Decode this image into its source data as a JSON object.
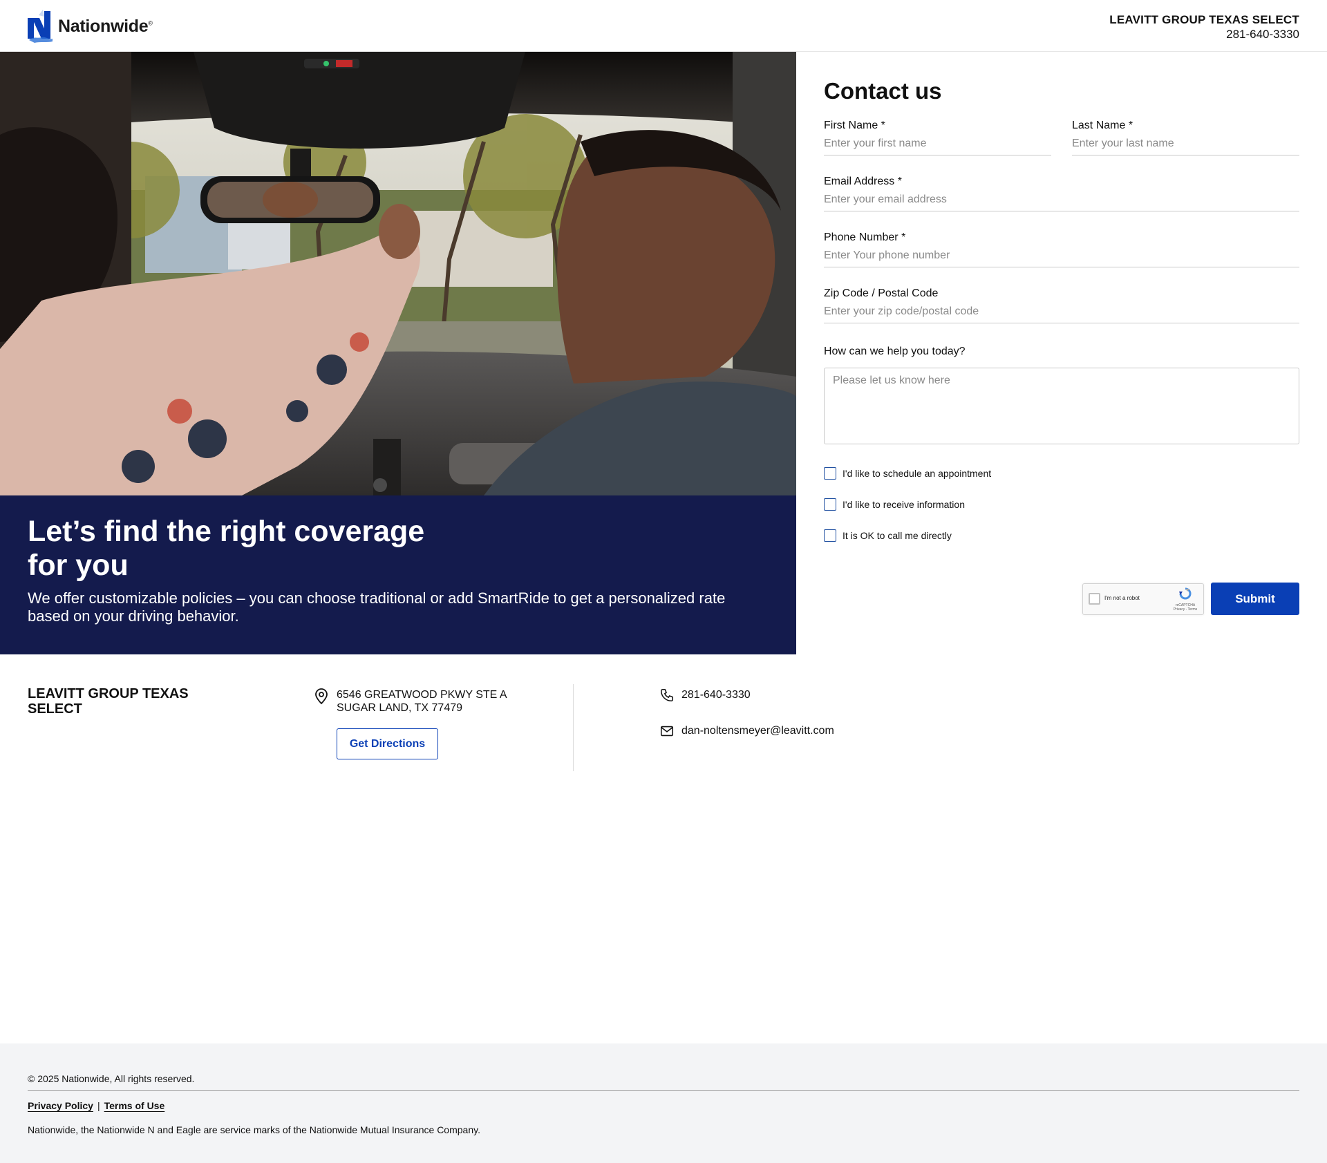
{
  "header": {
    "logo_text": "Nationwide",
    "logo_reg": "®",
    "agency_name": "LEAVITT GROUP TEXAS SELECT",
    "phone": "281-640-3330"
  },
  "hero": {
    "title": "Let’s find the right coverage for you",
    "subtitle": "We offer customizable policies – you can choose traditional or add SmartRide to get a personalized rate based on your driving behavior."
  },
  "form": {
    "title": "Contact us",
    "first_name": {
      "label": "First Name *",
      "placeholder": "Enter your first name",
      "value": ""
    },
    "last_name": {
      "label": "Last Name *",
      "placeholder": "Enter your last name",
      "value": ""
    },
    "email": {
      "label": "Email Address *",
      "placeholder": "Enter your email address",
      "value": ""
    },
    "phone": {
      "label": "Phone Number *",
      "placeholder": "Enter Your phone number",
      "value": ""
    },
    "zip": {
      "label": "Zip Code / Postal Code",
      "placeholder": "Enter your zip code/postal code",
      "value": ""
    },
    "help": {
      "label": "How can we help you today?",
      "placeholder": "Please let us know here"
    },
    "checkboxes": [
      {
        "label": "I'd like to schedule an appointment",
        "checked": false
      },
      {
        "label": "I'd like to receive information",
        "checked": false
      },
      {
        "label": "It is OK to call me directly",
        "checked": false
      }
    ],
    "recaptcha": {
      "label": "I'm not a robot",
      "brand": "reCAPTCHA",
      "links": "Privacy - Terms"
    },
    "submit_label": "Submit"
  },
  "agency": {
    "name": "LEAVITT GROUP TEXAS SELECT",
    "address_line1": "6546 GREATWOOD PKWY STE A",
    "address_line2": "SUGAR LAND, TX 77479",
    "directions_label": "Get Directions",
    "phone": "281-640-3330",
    "email": "dan-noltensmeyer@leavitt.com"
  },
  "footer": {
    "copyright": "© 2025 Nationwide, All rights reserved.",
    "privacy_label": "Privacy Policy",
    "separator": "|",
    "terms_label": "Terms of Use",
    "disclaimer": "Nationwide, the Nationwide N and Eagle are service marks of the Nationwide Mutual Insurance Company."
  },
  "colors": {
    "brand_blue": "#0a3fb5",
    "hero_navy": "#141b4d",
    "footer_bg": "#f3f4f6"
  }
}
